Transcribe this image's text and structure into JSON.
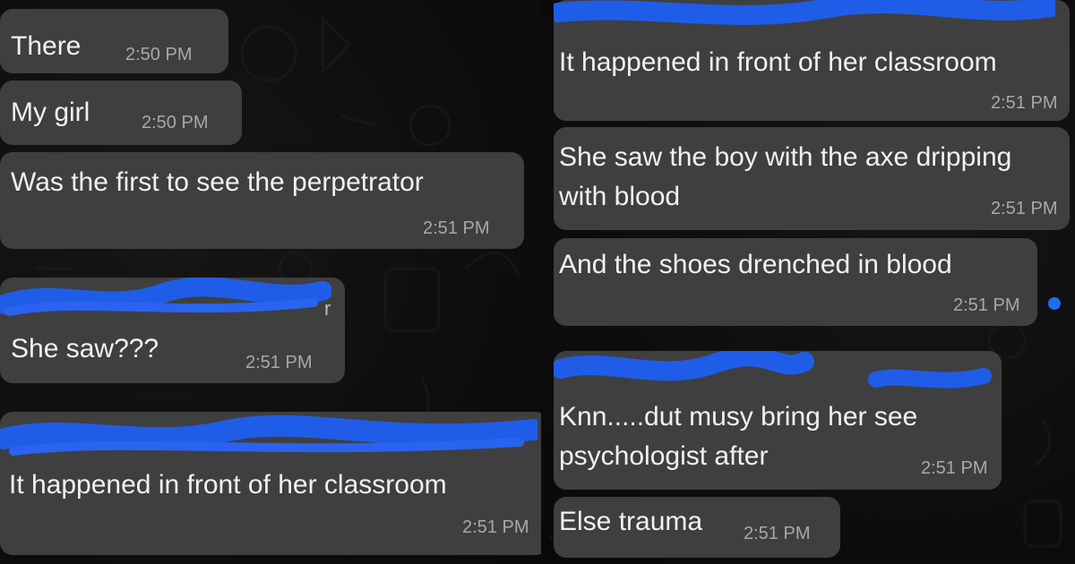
{
  "left": {
    "messages": [
      {
        "text": "There",
        "time": "2:50 PM"
      },
      {
        "text": "My girl",
        "time": "2:50 PM"
      },
      {
        "text": "Was the first to see the perpetrator",
        "time": "2:51 PM"
      },
      {
        "text": "She saw???",
        "time": "2:51 PM"
      },
      {
        "text": "It happened in front of her classroom",
        "time": "2:51 PM"
      }
    ]
  },
  "right": {
    "messages": [
      {
        "text": "It happened in front of her classroom",
        "time": "2:51 PM"
      },
      {
        "line1": "She saw the boy with the axe dripping",
        "line2": "with blood",
        "time": "2:51 PM"
      },
      {
        "text": "And the shoes drenched in blood",
        "time": "2:51 PM"
      },
      {
        "line1": "Knn.....dut musy bring her see",
        "line2": "psychologist after",
        "time": "2:51 PM"
      },
      {
        "text": "Else trauma",
        "time": "2:51 PM"
      }
    ]
  },
  "colors": {
    "bubble": "#3f3f3f",
    "text": "#f1f1f1",
    "timestamp": "#a8a8a8",
    "redaction": "#1f5de8",
    "background": "#0b0b0b"
  },
  "icons": {
    "status_dot": "blue-dot-icon",
    "background_pattern": "chat-wallpaper-doodles"
  }
}
